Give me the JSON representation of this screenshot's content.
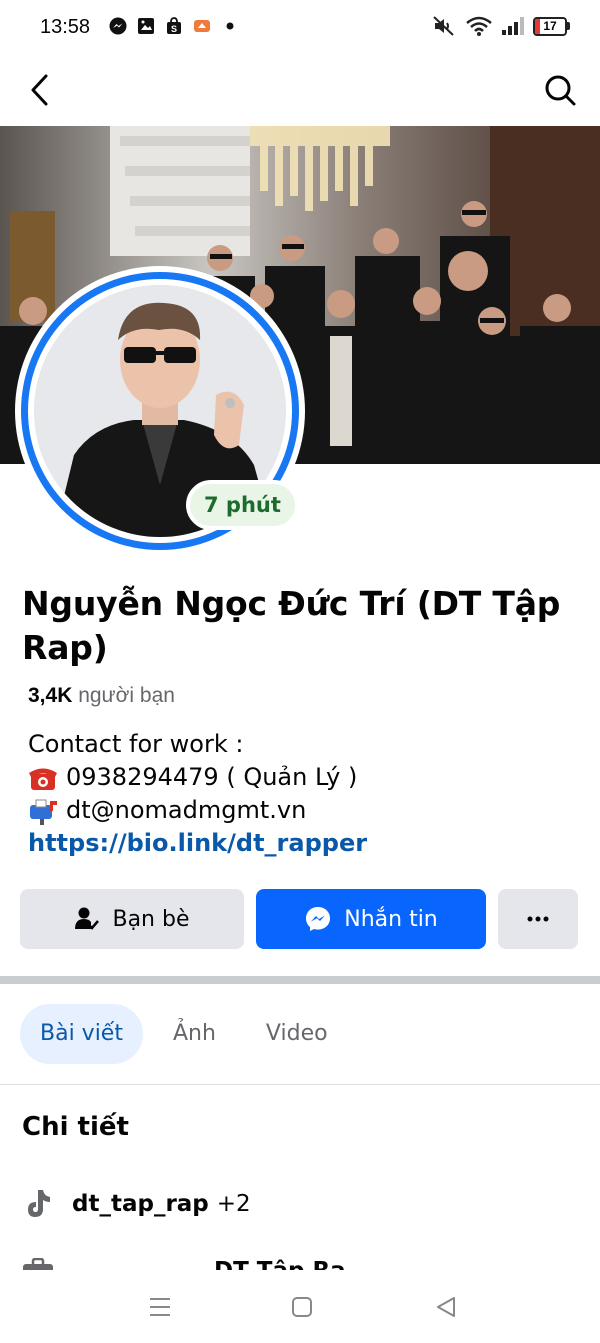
{
  "status_bar": {
    "time": "13:58",
    "left_icons": [
      "messenger-icon",
      "gallery-icon",
      "shop-icon",
      "app-icon",
      "dot-icon"
    ],
    "right_icons": [
      "mute-icon",
      "wifi-icon",
      "signal-icon"
    ],
    "battery_level": "17",
    "battery_color": "#e53935"
  },
  "nav": {
    "back_icon": "back-arrow-icon",
    "search_icon": "search-icon"
  },
  "profile": {
    "active_badge": "7 phút",
    "name": "Nguyễn Ngọc Đức Trí (DT Tập Rap)",
    "friends_count": "3,4K",
    "friends_label": "người bạn",
    "bio": {
      "line1": "Contact for work :",
      "phone": "0938294479 ( Quản Lý )",
      "email": "dt@nomadmgmt.vn",
      "link": "https://bio.link/dt_rapper"
    }
  },
  "actions": {
    "friends_label": "Bạn bè",
    "message_label": "Nhắn tin",
    "more_icon": "more-icon"
  },
  "tabs": [
    {
      "label": "Bài viết",
      "active": true
    },
    {
      "label": "Ảnh",
      "active": false
    },
    {
      "label": "Video",
      "active": false
    }
  ],
  "details": {
    "title": "Chi tiết",
    "tiktok_handle": "dt_tap_rap",
    "tiktok_extra": "+2",
    "partial_row": "DT Tập Ra"
  },
  "colors": {
    "accent": "#0866ff",
    "link": "#0a58a8",
    "avatar_ring": "#1877f2",
    "active_badge_text": "#1d6b2e"
  }
}
